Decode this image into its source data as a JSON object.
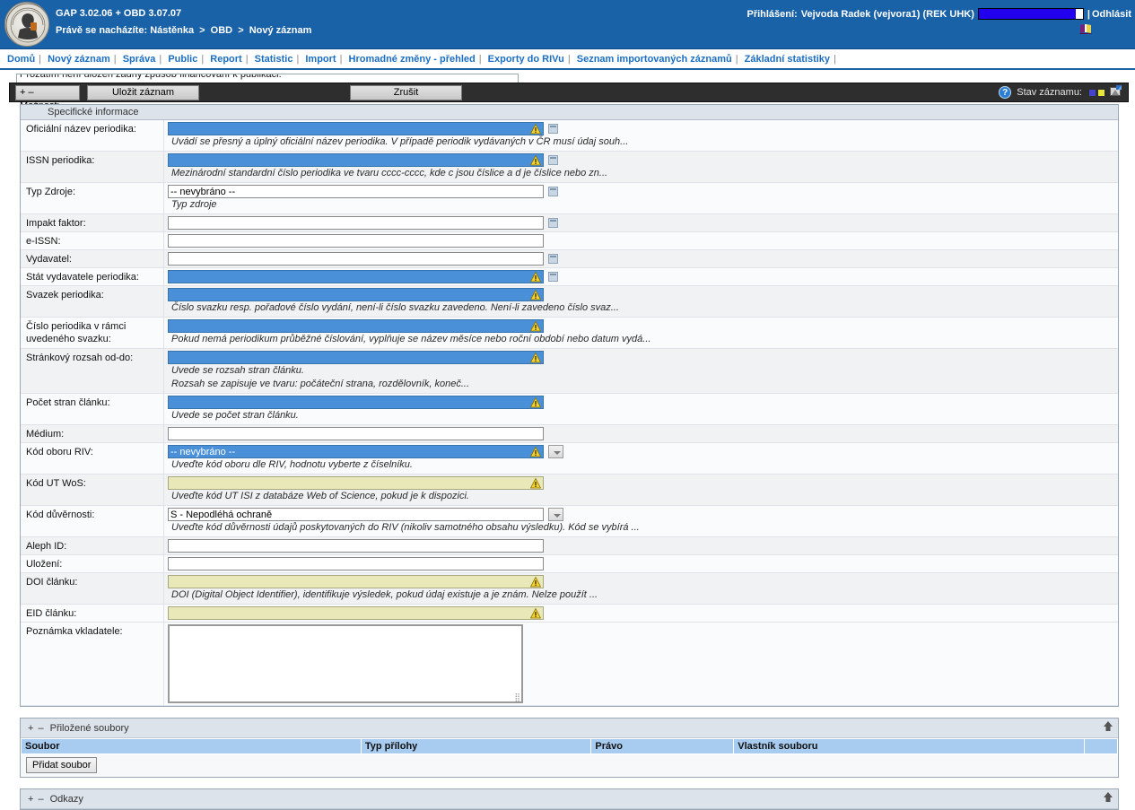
{
  "header": {
    "app_title": "GAP 3.02.06 + OBD 3.07.07",
    "breadcrumb_prefix": "Právě se nacházíte:",
    "breadcrumb": [
      "Nástěnka",
      "OBD",
      "Nový záznam"
    ],
    "login_label": "Přihlášení:",
    "user": "Vejvoda Radek (vejvora1) (REK UHK)",
    "logout": "Odhlásit",
    "separator": "|"
  },
  "nav": {
    "items": [
      "Domů",
      "Nový záznam",
      "Správa",
      "Public",
      "Report",
      "Statistic",
      "Import",
      "Hromadné změny - přehled",
      "Exporty do RIVu",
      "Seznam importovaných záznamů",
      "Základní statistiky"
    ],
    "separator": "|"
  },
  "clipped_message": "Prozatím není uložen žádný způsob financování k publikaci.",
  "toolbar": {
    "options_label": "+ – Možnosti",
    "save_label": "Uložit záznam",
    "cancel_label": "Zrušit",
    "help_label": "?",
    "status_label": "Stav záznamu:"
  },
  "panel": {
    "title": "Specifické informace"
  },
  "fields": [
    {
      "label": "Oficiální název periodika:",
      "value": "",
      "style": "required",
      "warn": true,
      "note": true,
      "dropdown": false,
      "hints": [
        "Uvádí se přesný a úplný oficiální název periodika. V případě periodik vydávaných v ČR musí údaj souh..."
      ]
    },
    {
      "label": "ISSN periodika:",
      "value": "",
      "style": "required",
      "warn": true,
      "note": true,
      "dropdown": false,
      "hints": [
        "Mezinárodní standardní číslo periodika ve tvaru cccc-cccc, kde c jsou číslice a d je číslice nebo zn..."
      ]
    },
    {
      "label": "Typ Zdroje:",
      "value": "-- nevybráno --",
      "style": "plain",
      "warn": false,
      "note": true,
      "dropdown": false,
      "hints": [
        "Typ zdroje"
      ]
    },
    {
      "label": "Impakt faktor:",
      "value": "",
      "style": "plain",
      "warn": false,
      "note": true,
      "dropdown": false,
      "hints": []
    },
    {
      "label": "e-ISSN:",
      "value": "",
      "style": "plain",
      "warn": false,
      "note": false,
      "dropdown": false,
      "hints": []
    },
    {
      "label": "Vydavatel:",
      "value": "",
      "style": "plain",
      "warn": false,
      "note": true,
      "dropdown": false,
      "hints": []
    },
    {
      "label": "Stát vydavatele periodika:",
      "value": "",
      "style": "required",
      "warn": true,
      "note": true,
      "dropdown": false,
      "hints": []
    },
    {
      "label": "Svazek periodika:",
      "value": "",
      "style": "required",
      "warn": true,
      "note": false,
      "dropdown": false,
      "hints": [
        "Číslo svazku resp. pořadové číslo vydání, není-li číslo svazku zavedeno. Není-li zavedeno číslo svaz..."
      ]
    },
    {
      "label": "Číslo periodika v rámci uvedeného svazku:",
      "value": "",
      "style": "required",
      "warn": true,
      "note": false,
      "dropdown": false,
      "hints": [
        "Pokud nemá periodikum průběžné číslování, vyplňuje se název měsíce nebo roční období nebo datum vydá..."
      ]
    },
    {
      "label": "Stránkový rozsah od-do:",
      "value": "",
      "style": "required",
      "warn": true,
      "note": false,
      "dropdown": false,
      "hints": [
        "Uvede se rozsah stran článku.",
        "Rozsah se zapisuje ve tvaru: počáteční strana, rozdělovník, koneč..."
      ]
    },
    {
      "label": "Počet stran článku:",
      "value": "",
      "style": "required",
      "warn": true,
      "note": false,
      "dropdown": false,
      "hints": [
        "Uvede se počet stran článku."
      ]
    },
    {
      "label": "Médium:",
      "value": "",
      "style": "plain",
      "warn": false,
      "note": false,
      "dropdown": false,
      "hints": []
    },
    {
      "label": "Kód oboru RIV:",
      "value": "-- nevybráno --",
      "style": "required",
      "warn": true,
      "note": false,
      "dropdown": true,
      "hints": [
        "Uveďte kód oboru dle RIV, hodnotu vyberte z číselníku."
      ]
    },
    {
      "label": "Kód UT WoS:",
      "value": "",
      "style": "warnfill",
      "warn": true,
      "note": false,
      "dropdown": false,
      "hints": [
        "Uveďte kód UT ISI z databáze Web of Science, pokud je k dispozici."
      ]
    },
    {
      "label": "Kód důvěrnosti:",
      "value": "S - Nepodléhá ochraně",
      "style": "plain",
      "warn": false,
      "note": false,
      "dropdown": true,
      "hints": [
        "Uveďte kód důvěrnosti údajů poskytovaných do RIV (nikoliv samotného obsahu výsledku). Kód se vybírá ..."
      ]
    },
    {
      "label": "Aleph ID:",
      "value": "",
      "style": "plain",
      "warn": false,
      "note": false,
      "dropdown": false,
      "hints": []
    },
    {
      "label": "Uložení:",
      "value": "",
      "style": "plain",
      "warn": false,
      "note": false,
      "dropdown": false,
      "hints": []
    },
    {
      "label": "DOI článku:",
      "value": "",
      "style": "warnfill",
      "warn": true,
      "note": false,
      "dropdown": false,
      "hints": [
        "DOI (Digital Object Identifier), identifikuje výsledek, pokud údaj existuje a je znám. Nelze použít ..."
      ]
    },
    {
      "label": "EID článku:",
      "value": "",
      "style": "warnfill",
      "warn": true,
      "note": false,
      "dropdown": false,
      "hints": []
    }
  ],
  "note_field": {
    "label": "Poznámka vkladatele:",
    "value": ""
  },
  "files_section": {
    "toggle": "+ –",
    "title": "Příloţené soubory",
    "title_text": "Přiložené soubory",
    "columns": [
      "Soubor",
      "Typ přílohy",
      "Právo",
      "Vlastník souboru",
      ""
    ],
    "rows": [],
    "add_button": "Přidat soubor"
  },
  "links_section": {
    "toggle": "+ –",
    "title": "Odkazy"
  }
}
